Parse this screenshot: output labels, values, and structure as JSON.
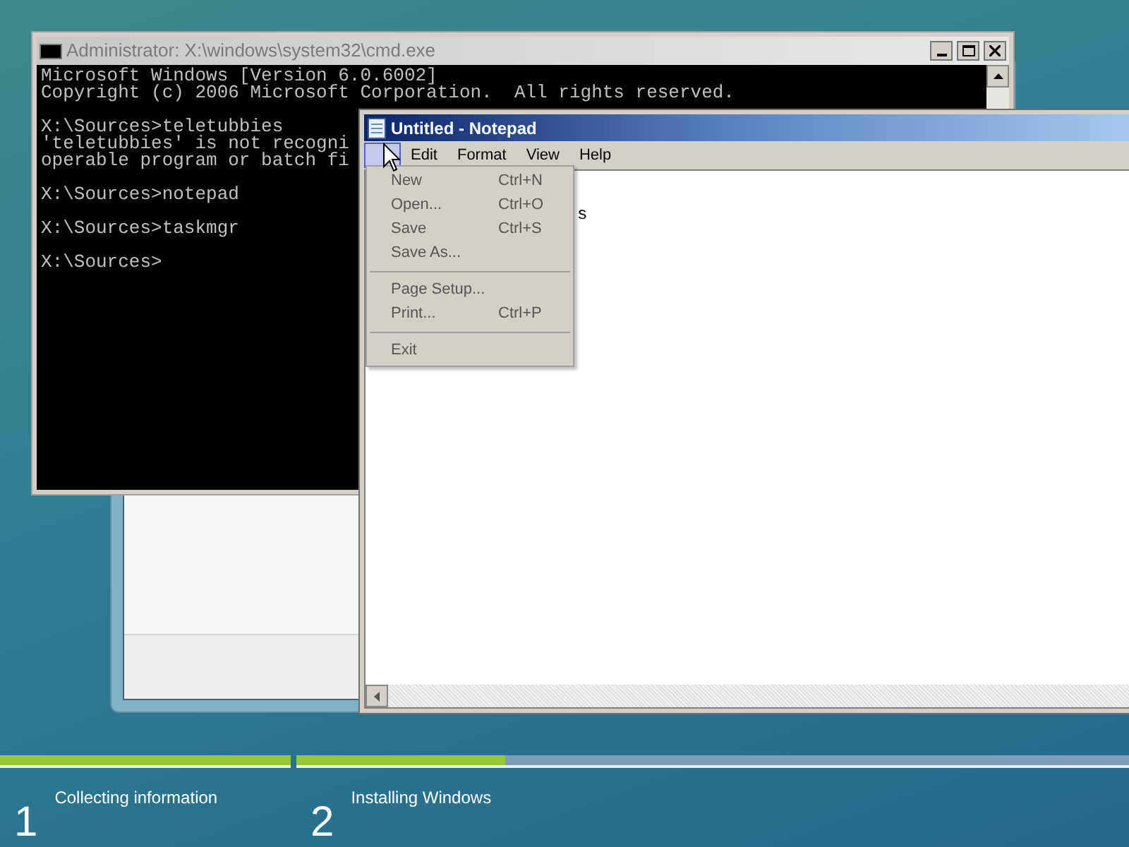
{
  "cmd_window": {
    "title": "Administrator: X:\\windows\\system32\\cmd.exe",
    "lines": [
      {
        "text": "Microsoft Windows [Version 6.0.6002]",
        "blank_before": false
      },
      {
        "text": "Copyright (c) 2006 Microsoft Corporation.  All rights reserved.",
        "blank_before": false
      },
      {
        "text": "X:\\Sources>teletubbies",
        "blank_before": true
      },
      {
        "text": "'teletubbies' is not recogni",
        "blank_before": false
      },
      {
        "text": "operable program or batch fi",
        "blank_before": false
      },
      {
        "text": "X:\\Sources>notepad",
        "blank_before": true
      },
      {
        "text": "X:\\Sources>taskmgr",
        "blank_before": true
      },
      {
        "text": "X:\\Sources>",
        "blank_before": true
      }
    ]
  },
  "notepad": {
    "title": "Untitled - Notepad",
    "menus": [
      {
        "selected": true
      },
      {
        "label": "Edit",
        "selected": false
      },
      {
        "label": "Format",
        "selected": false
      },
      {
        "label": "View",
        "selected": false
      },
      {
        "label": "Help",
        "selected": false
      }
    ],
    "text": "s",
    "file_menu": [
      {
        "kind": "item",
        "label": "New",
        "shortcut": "Ctrl+N"
      },
      {
        "kind": "item",
        "label": "Open...",
        "shortcut": "Ctrl+O"
      },
      {
        "kind": "item",
        "label": "Save",
        "shortcut": "Ctrl+S"
      },
      {
        "kind": "item",
        "label": "Save As..."
      },
      {
        "kind": "separator"
      },
      {
        "kind": "item",
        "label": "Page Setup..."
      },
      {
        "kind": "item",
        "label": "Print...",
        "shortcut": "Ctrl+P"
      },
      {
        "kind": "separator"
      },
      {
        "kind": "item",
        "label": "Exit"
      }
    ]
  },
  "setup_progress": [
    {
      "number": "1",
      "label": "Collecting information",
      "level": 1
    },
    {
      "number": "2",
      "label": "Installing Windows",
      "level": 0.25
    }
  ]
}
